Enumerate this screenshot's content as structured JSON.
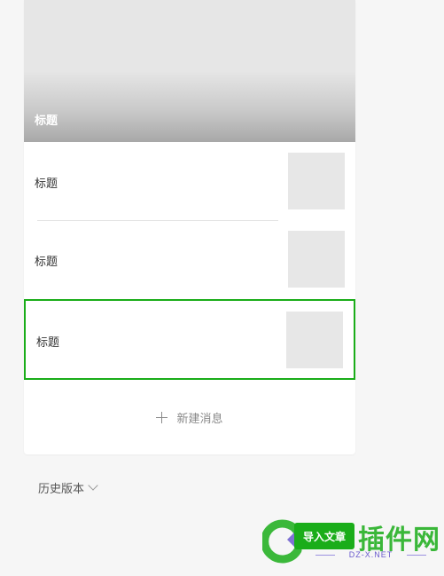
{
  "cover": {
    "title": "标题"
  },
  "items": [
    {
      "title": "标题"
    },
    {
      "title": "标题"
    },
    {
      "title": "标题"
    }
  ],
  "actions": {
    "new_message_label": "新建消息",
    "history_label": "历史版本",
    "import_label": "导入文章"
  },
  "watermark": {
    "brand": "插件网",
    "domain": "DZ-X.NET"
  },
  "colors": {
    "accent": "#1aad19",
    "thumb": "#e7e7e7",
    "background": "#f6f6f6"
  }
}
